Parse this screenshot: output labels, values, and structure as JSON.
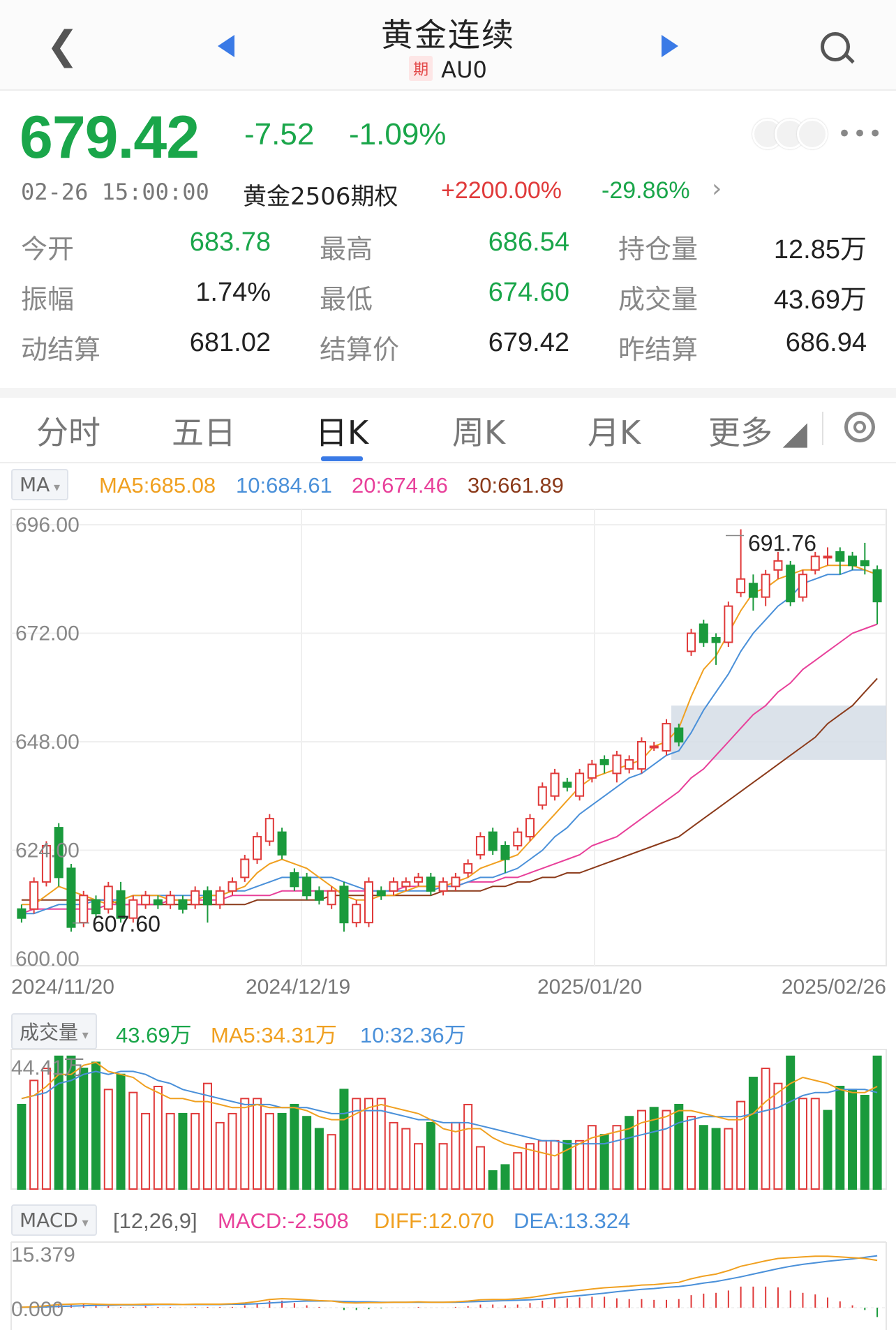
{
  "header": {
    "title": "黄金连续",
    "badge": "期",
    "code": "AU0"
  },
  "quote": {
    "price": "679.42",
    "change": "-7.52",
    "change_pct": "-1.09%",
    "time": "02-26 15:00:00",
    "option_name": "黄金2506期权",
    "option_up": "+2200.00%",
    "option_down": "-29.86%"
  },
  "stats": [
    {
      "label": "今开",
      "value": "683.78",
      "color": "#1aa64a"
    },
    {
      "label": "最高",
      "value": "686.54",
      "color": "#1aa64a"
    },
    {
      "label": "持仓量",
      "value": "12.85万",
      "color": "#222222"
    },
    {
      "label": "振幅",
      "value": "1.74%",
      "color": "#222222"
    },
    {
      "label": "最低",
      "value": "674.60",
      "color": "#1aa64a"
    },
    {
      "label": "成交量",
      "value": "43.69万",
      "color": "#222222"
    },
    {
      "label": "动结算",
      "value": "681.02",
      "color": "#222222"
    },
    {
      "label": "结算价",
      "value": "679.42",
      "color": "#222222"
    },
    {
      "label": "昨结算",
      "value": "686.94",
      "color": "#222222"
    }
  ],
  "tabs": [
    "分时",
    "五日",
    "日K",
    "周K",
    "月K",
    "更多"
  ],
  "active_tab": "日K",
  "ma_legend": {
    "selector": "MA",
    "ma5": "MA5:685.08",
    "ma10": "10:684.61",
    "ma20": "20:674.46",
    "ma30": "30:661.89"
  },
  "price_axis": {
    "labels": [
      "696.00",
      "672.00",
      "648.00",
      "624.00",
      "600.00"
    ],
    "max_label": "691.76",
    "min_label": "607.60"
  },
  "date_labels": [
    "2024/11/20",
    "2024/12/19",
    "2025/01/20",
    "2025/02/26"
  ],
  "volume_legend": {
    "selector": "成交量",
    "vol": "43.69万",
    "ma5": "MA5:34.31万",
    "ma10": "10:32.36万",
    "axis_max": "44.41万"
  },
  "macd_legend": {
    "selector": "MACD",
    "params": "[12,26,9]",
    "macd": "MACD:-2.508",
    "diff": "DIFF:12.070",
    "dea": "DEA:13.324",
    "axis_max": "15.379",
    "axis_zero": "0.000"
  },
  "colors": {
    "up": "#e03a3a",
    "down": "#1a9a3c",
    "ma5": "#f0a020",
    "ma10": "#4a90d9",
    "ma20": "#e8409a",
    "ma30": "#8b3a1a",
    "accent": "#3a7ae6"
  },
  "chart_data": {
    "type": "candlestick",
    "y_range": [
      600,
      696
    ],
    "candles": [
      [
        611,
        609,
        612,
        608
      ],
      [
        611,
        617,
        618,
        610
      ],
      [
        617,
        625,
        626,
        616
      ],
      [
        629,
        618,
        630,
        616
      ],
      [
        620,
        607,
        621,
        606
      ],
      [
        608,
        614,
        615,
        607
      ],
      [
        613,
        610,
        614,
        609
      ],
      [
        611,
        616,
        617,
        610
      ],
      [
        615,
        609,
        617,
        608
      ],
      [
        609,
        613,
        614,
        608
      ],
      [
        612,
        614,
        615,
        611
      ],
      [
        613,
        612,
        614,
        611
      ],
      [
        612,
        614,
        615,
        611
      ],
      [
        613,
        611,
        614,
        610
      ],
      [
        612,
        615,
        616,
        611
      ],
      [
        615,
        612,
        616,
        608
      ],
      [
        612,
        615,
        616,
        611
      ],
      [
        615,
        617,
        618,
        614
      ],
      [
        618,
        622,
        623,
        617
      ],
      [
        622,
        627,
        628,
        621
      ],
      [
        626,
        631,
        632,
        625
      ],
      [
        628,
        623,
        629,
        622
      ],
      [
        619,
        616,
        620,
        615
      ],
      [
        618,
        614,
        619,
        613
      ],
      [
        615,
        613,
        616,
        612
      ],
      [
        612,
        615,
        616,
        611
      ],
      [
        616,
        608,
        617,
        606
      ],
      [
        608,
        612,
        613,
        607
      ],
      [
        608,
        617,
        618,
        607
      ],
      [
        615,
        614,
        616,
        613
      ],
      [
        615,
        617,
        618,
        614
      ],
      [
        616,
        617,
        618,
        615
      ],
      [
        617,
        618,
        619,
        616
      ],
      [
        618,
        615,
        619,
        614
      ],
      [
        615,
        617,
        618,
        614
      ],
      [
        616,
        618,
        619,
        615
      ],
      [
        619,
        621,
        622,
        618
      ],
      [
        623,
        627,
        628,
        622
      ],
      [
        628,
        624,
        629,
        623
      ],
      [
        625,
        622,
        626,
        619
      ],
      [
        625,
        628,
        629,
        624
      ],
      [
        627,
        631,
        632,
        626
      ],
      [
        634,
        638,
        639,
        633
      ],
      [
        636,
        641,
        642,
        635
      ],
      [
        639,
        638,
        640,
        637
      ],
      [
        636,
        641,
        642,
        635
      ],
      [
        640,
        643,
        644,
        639
      ],
      [
        644,
        643,
        645,
        641
      ],
      [
        641,
        645,
        646,
        639
      ],
      [
        642,
        644,
        645,
        641
      ],
      [
        642,
        648,
        649,
        641
      ],
      [
        647,
        647,
        648,
        646
      ],
      [
        646,
        652,
        653,
        645
      ],
      [
        651,
        648,
        652,
        647
      ],
      [
        668,
        672,
        673,
        667
      ],
      [
        674,
        670,
        675,
        669
      ],
      [
        671,
        670,
        672,
        665
      ],
      [
        670,
        678,
        679,
        669
      ],
      [
        681,
        684,
        695,
        680
      ],
      [
        683,
        680,
        685,
        677
      ],
      [
        680,
        685,
        686,
        678
      ],
      [
        686,
        688,
        690,
        684
      ],
      [
        687,
        679,
        688,
        678
      ],
      [
        680,
        685,
        686,
        679
      ],
      [
        686,
        689,
        690,
        685
      ],
      [
        689,
        689,
        691,
        687
      ],
      [
        690,
        688,
        691,
        685
      ],
      [
        689,
        687,
        690,
        686
      ],
      [
        688,
        687,
        692,
        685
      ],
      [
        686,
        679,
        687,
        674
      ]
    ],
    "ma5": [
      612,
      612,
      614,
      616,
      615,
      614,
      613,
      612,
      613,
      614,
      614,
      614,
      613,
      613,
      613,
      614,
      614,
      615,
      616,
      619,
      621,
      622,
      621,
      620,
      618,
      616,
      614,
      613,
      613,
      614,
      614,
      615,
      616,
      616,
      616,
      617,
      618,
      620,
      621,
      622,
      623,
      626,
      629,
      632,
      635,
      638,
      640,
      641,
      642,
      643,
      644,
      647,
      648,
      651,
      658,
      664,
      667,
      672,
      677,
      681,
      682,
      684,
      685,
      686,
      686,
      687,
      687,
      687,
      686,
      685
    ],
    "ma10": [
      610,
      610,
      611,
      612,
      612,
      612,
      613,
      613,
      613,
      614,
      614,
      614,
      614,
      614,
      614,
      614,
      614,
      615,
      615,
      616,
      617,
      618,
      618,
      618,
      618,
      618,
      617,
      616,
      615,
      615,
      615,
      615,
      615,
      615,
      616,
      616,
      617,
      618,
      618,
      619,
      620,
      622,
      624,
      627,
      629,
      632,
      634,
      636,
      638,
      640,
      641,
      643,
      645,
      646,
      650,
      655,
      659,
      663,
      668,
      672,
      675,
      678,
      680,
      683,
      684,
      685,
      685,
      686,
      686,
      685
    ],
    "ma20": [
      610,
      611,
      611,
      611,
      611,
      611,
      611,
      612,
      612,
      612,
      612,
      612,
      613,
      613,
      613,
      613,
      613,
      614,
      614,
      614,
      614,
      615,
      615,
      615,
      615,
      615,
      615,
      615,
      615,
      615,
      615,
      616,
      616,
      616,
      616,
      616,
      617,
      617,
      617,
      618,
      618,
      619,
      620,
      621,
      622,
      623,
      625,
      626,
      627,
      629,
      631,
      633,
      635,
      637,
      640,
      642,
      645,
      648,
      651,
      654,
      656,
      659,
      661,
      664,
      666,
      668,
      670,
      672,
      673,
      674
    ],
    "ma30": [
      613,
      613,
      613,
      613,
      613,
      613,
      613,
      613,
      612,
      612,
      612,
      612,
      612,
      612,
      612,
      612,
      612,
      612,
      612,
      613,
      613,
      613,
      613,
      613,
      613,
      614,
      614,
      614,
      614,
      614,
      614,
      614,
      614,
      614,
      615,
      615,
      615,
      615,
      616,
      616,
      617,
      617,
      618,
      618,
      619,
      619,
      620,
      621,
      622,
      623,
      624,
      625,
      626,
      627,
      629,
      631,
      633,
      635,
      637,
      639,
      641,
      643,
      645,
      647,
      649,
      652,
      654,
      656,
      659,
      662
    ],
    "volume": [
      28,
      36,
      40,
      44,
      44,
      40,
      42,
      33,
      38,
      32,
      25,
      34,
      25,
      25,
      25,
      35,
      22,
      25,
      30,
      30,
      25,
      25,
      28,
      24,
      20,
      18,
      33,
      30,
      30,
      30,
      22,
      20,
      15,
      22,
      15,
      22,
      28,
      14,
      6,
      8,
      12,
      15,
      16,
      16,
      16,
      16,
      21,
      18,
      21,
      24,
      26,
      27,
      26,
      28,
      24,
      21,
      20,
      20,
      29,
      37,
      40,
      35,
      44,
      30,
      30,
      26,
      34,
      33,
      31,
      44
    ],
    "volume_up": [
      false,
      true,
      true,
      false,
      false,
      false,
      false,
      true,
      false,
      true,
      true,
      true,
      true,
      false,
      true,
      true,
      true,
      true,
      true,
      true,
      true,
      false,
      false,
      false,
      false,
      true,
      false,
      true,
      true,
      true,
      true,
      true,
      true,
      false,
      true,
      true,
      true,
      true,
      false,
      false,
      true,
      true,
      true,
      true,
      false,
      true,
      true,
      false,
      true,
      false,
      true,
      false,
      true,
      false,
      true,
      false,
      false,
      true,
      true,
      false,
      true,
      true,
      false,
      true,
      true,
      false,
      false,
      false,
      false,
      false
    ],
    "volume_ma5": [
      30,
      31,
      34,
      38,
      38,
      41,
      42,
      39,
      38,
      37,
      34,
      32,
      30,
      30,
      29,
      29,
      28,
      27,
      27,
      28,
      27,
      27,
      27,
      26,
      24,
      23,
      23,
      25,
      27,
      28,
      27,
      26,
      25,
      23,
      20,
      19,
      20,
      20,
      17,
      15,
      14,
      13,
      12,
      11,
      13,
      15,
      17,
      18,
      19,
      20,
      22,
      23,
      24,
      26,
      26,
      25,
      24,
      23,
      23,
      25,
      29,
      32,
      35,
      37,
      36,
      35,
      33,
      32,
      32,
      34
    ],
    "volume_ma10": [
      30,
      31,
      32,
      35,
      36,
      38,
      39,
      38,
      39,
      39,
      38,
      36,
      35,
      33,
      32,
      31,
      30,
      29,
      28,
      28,
      28,
      27,
      27,
      27,
      26,
      25,
      25,
      26,
      26,
      26,
      25,
      24,
      23,
      23,
      22,
      22,
      22,
      21,
      20,
      19,
      18,
      17,
      16,
      16,
      15,
      15,
      15,
      15,
      16,
      17,
      18,
      19,
      20,
      22,
      23,
      24,
      24,
      24,
      24,
      25,
      26,
      27,
      29,
      31,
      32,
      32,
      33,
      33,
      33,
      32
    ],
    "macd_diff": [
      0.1,
      0.2,
      0.5,
      0.8,
      0.9,
      1.0,
      0.9,
      0.8,
      0.8,
      0.8,
      0.9,
      0.9,
      0.9,
      0.8,
      0.9,
      0.9,
      0.9,
      1.0,
      1.2,
      1.6,
      2.1,
      2.3,
      2.2,
      2.0,
      1.8,
      1.7,
      1.3,
      1.2,
      1.3,
      1.3,
      1.4,
      1.4,
      1.5,
      1.4,
      1.4,
      1.5,
      1.7,
      2.0,
      2.1,
      2.1,
      2.3,
      2.6,
      3.1,
      3.6,
      4.0,
      4.4,
      4.8,
      5.1,
      5.3,
      5.5,
      5.8,
      5.9,
      6.2,
      6.5,
      7.4,
      8.1,
      8.6,
      9.5,
      10.6,
      11.3,
      12.0,
      12.6,
      12.8,
      13.0,
      13.2,
      13.2,
      13.0,
      12.8,
      12.6,
      12.1
    ],
    "macd_dea": [
      0.1,
      0.1,
      0.2,
      0.3,
      0.4,
      0.5,
      0.6,
      0.6,
      0.7,
      0.7,
      0.7,
      0.8,
      0.8,
      0.8,
      0.8,
      0.8,
      0.8,
      0.9,
      0.9,
      1.0,
      1.2,
      1.4,
      1.6,
      1.7,
      1.7,
      1.7,
      1.6,
      1.5,
      1.5,
      1.4,
      1.4,
      1.4,
      1.4,
      1.4,
      1.4,
      1.4,
      1.5,
      1.6,
      1.7,
      1.8,
      1.9,
      2.0,
      2.2,
      2.5,
      2.8,
      3.1,
      3.4,
      3.7,
      4.1,
      4.4,
      4.7,
      4.9,
      5.2,
      5.4,
      5.8,
      6.3,
      6.7,
      7.3,
      7.9,
      8.6,
      9.3,
      10.0,
      10.6,
      11.1,
      11.5,
      11.9,
      12.2,
      12.5,
      12.9,
      13.3
    ]
  }
}
